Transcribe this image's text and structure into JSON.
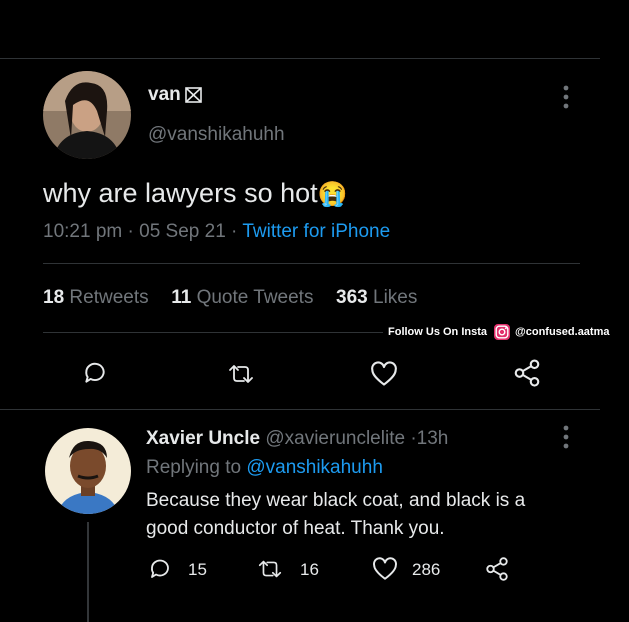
{
  "tweet": {
    "display_name": "van",
    "name_icon": "crossed-square-icon",
    "handle": "@vanshikahuhh",
    "text": "why are lawyers so hot",
    "emoji": "😭",
    "time": "10:21 pm",
    "sep1": "·",
    "date": "05 Sep 21",
    "sep2": "·",
    "source": "Twitter for iPhone",
    "stats": {
      "retweets_count": "18",
      "retweets_label": "Retweets",
      "quotes_count": "11",
      "quotes_label": "Quote Tweets",
      "likes_count": "363",
      "likes_label": "Likes"
    }
  },
  "watermark": {
    "text": "Follow Us On Insta",
    "handle": "@confused.aatma",
    "icon": "instagram-icon",
    "color": "#e1306c"
  },
  "reply": {
    "display_name": "Xavier Uncle",
    "handle": "@xavierunclelite",
    "sep": "·",
    "time": "13h",
    "replying_label": "Replying to",
    "replying_to": "@vanshikahuhh",
    "text_line1": "Because they wear black coat, and black is a",
    "text_line2": "good conductor of heat. Thank you.",
    "replies": "15",
    "retweets": "16",
    "likes": "286"
  },
  "colors": {
    "background": "#000000",
    "text": "#e7e9ea",
    "muted": "#71767b",
    "link": "#1d9bf0",
    "divider": "#2f3336"
  }
}
